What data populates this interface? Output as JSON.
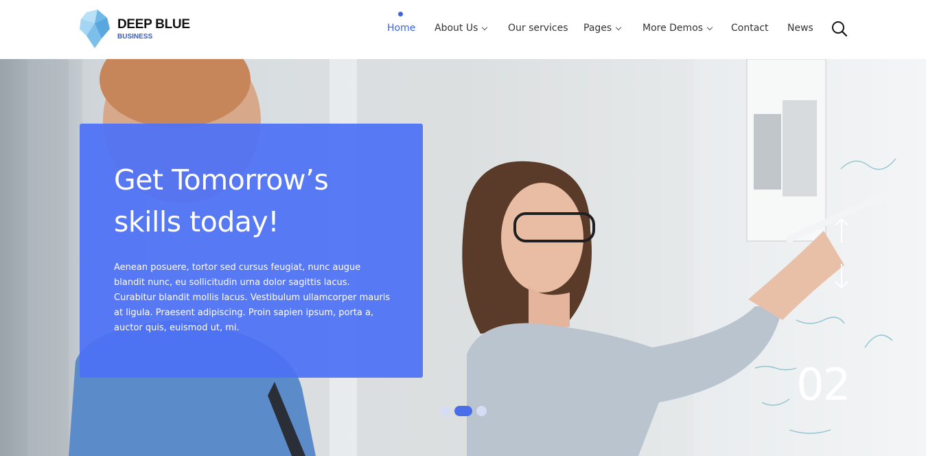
{
  "brand": {
    "title": "DEEP BLUE",
    "subtitle": "BUSINESS"
  },
  "nav": {
    "items": [
      {
        "label": "Home",
        "active": true,
        "dropdown": false
      },
      {
        "label": "About Us",
        "active": false,
        "dropdown": true
      },
      {
        "label": "Our services",
        "active": false,
        "dropdown": false
      },
      {
        "label": "Pages",
        "active": false,
        "dropdown": true
      },
      {
        "label": "More Demos",
        "active": false,
        "dropdown": true
      },
      {
        "label": "Contact",
        "active": false,
        "dropdown": false
      },
      {
        "label": "News",
        "active": false,
        "dropdown": false
      }
    ],
    "search_icon": "search-icon"
  },
  "hero": {
    "title_line1": "Get Tomorrow’s",
    "title_line2": "skills today!",
    "text": "Aenean posuere, tortor sed cursus feugiat, nunc augue blandit nunc, eu sollicitudin urna dolor sagittis lacus. Curabitur blandit mollis lacus. Vestibulum ullamcorper mauris at ligula. Praesent adipiscing. Proin sapien ipsum, porta a, auctor quis, euismod ut, mi.",
    "slide_number": "02",
    "active_slide": 2,
    "slide_count": 3
  },
  "colors": {
    "accent": "#3d63dd",
    "card": "#4e71f5",
    "dot_active": "#4a6eea",
    "dot_inactive": "#d5dcf4"
  }
}
